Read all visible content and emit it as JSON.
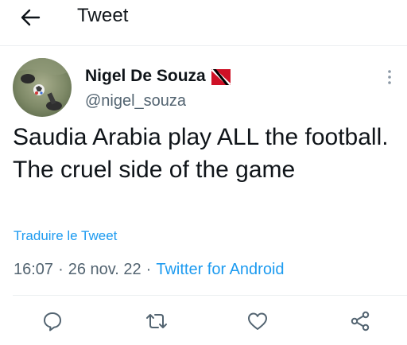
{
  "header": {
    "title": "Tweet",
    "back_icon": "arrow-left-icon"
  },
  "author": {
    "display_name": "Nigel De Souza",
    "handle": "@nigel_souza",
    "flag_icon": "trinidad-and-tobago-flag-icon",
    "more_icon": "vertical-ellipsis-icon"
  },
  "tweet": {
    "text": "Saudia Arabia play ALL the football. The cruel side of the game",
    "translate_label": "Traduire le Tweet",
    "time": "16:07",
    "date": "26 nov. 22",
    "source": "Twitter for Android",
    "separator": "·"
  },
  "actions": [
    {
      "icon": "reply-icon"
    },
    {
      "icon": "retweet-icon"
    },
    {
      "icon": "like-icon"
    },
    {
      "icon": "share-icon"
    }
  ],
  "colors": {
    "link": "#1d9bf0",
    "text": "#0f1419",
    "secondary": "#536471",
    "divider": "#eceff1",
    "flag_red": "#ce1126",
    "flag_black": "#000000"
  }
}
